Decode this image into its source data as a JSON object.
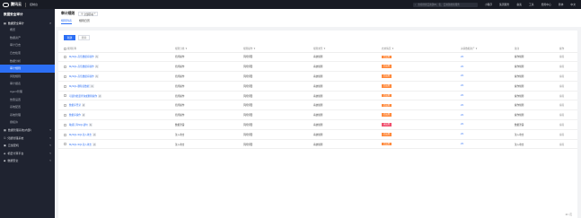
{
  "topbar": {
    "logo_text": "腾讯云",
    "console": "控制台",
    "search_placeholder": "支持搜索云资源ID、名、云资源搜索服务",
    "links": [
      "小程序",
      "集团服务",
      "备案",
      "工具",
      "费用中心",
      "简体",
      "中文"
    ]
  },
  "sidebar": {
    "title": "数据安全审计",
    "group_label": "数据安全审计",
    "items": [
      {
        "label": "概览",
        "active": false
      },
      {
        "label": "数据资产",
        "active": false
      },
      {
        "label": "审计日志",
        "active": false
      },
      {
        "label": "日志检索",
        "active": false
      },
      {
        "label": "数据分析",
        "active": false
      },
      {
        "label": "审计规则",
        "active": true
      },
      {
        "label": "风险规则",
        "active": false
      },
      {
        "label": "审计报表",
        "active": false
      },
      {
        "label": "Agent管理",
        "active": false
      },
      {
        "label": "告警设置",
        "active": false
      },
      {
        "label": "系统配置",
        "active": false
      },
      {
        "label": "系统管理",
        "active": false
      },
      {
        "label": "授权许",
        "active": false
      }
    ],
    "categories": [
      {
        "label": "数据管理系统(内部)"
      },
      {
        "label": "凭据管理系统"
      },
      {
        "label": "云加密机"
      },
      {
        "label": "机密计算平台"
      },
      {
        "label": "数据安全"
      }
    ]
  },
  "page": {
    "title": "审计规则",
    "region": "全部区域",
    "tabs": [
      {
        "label": "规则列表",
        "active": true
      },
      {
        "label": "规则日历",
        "active": false
      }
    ]
  },
  "toolbar": {
    "new_label": "新建",
    "delete_label": "删除"
  },
  "table": {
    "columns": [
      "规则名称",
      "规则分类 ▼",
      "规则操作 ▼",
      "规则类型 ▼",
      "启用情况 ▼",
      "关联数据资产 ▼",
      "备注",
      "操作"
    ],
    "rows": [
      {
        "name": "MySQL-高危数据库操作",
        "tag": "内",
        "category": "危险操作",
        "action": "风险预警",
        "type": "系统规则",
        "status": "已启用",
        "status_color": "#ff8a3d",
        "count": "23",
        "note": "操作规则",
        "op": "编辑"
      },
      {
        "name": "MySQL-高危数据库操作",
        "tag": "内",
        "category": "危险操作",
        "action": "风险预警",
        "type": "系统规则",
        "status": "已启用",
        "status_color": "#ff8a3d",
        "count": "23",
        "note": "操作规则",
        "op": "编辑"
      },
      {
        "name": "MySQL-高危数据库操作",
        "tag": "内",
        "category": "危险操作",
        "action": "风险预警",
        "type": "系统规则",
        "status": "已启用",
        "status_color": "#ff8a3d",
        "count": "23",
        "note": "操作规则",
        "op": "编辑"
      },
      {
        "name": "MySQL-删除表数据",
        "tag": "内",
        "category": "危险操作",
        "action": "风险预警",
        "type": "系统规则",
        "status": "已启用",
        "status_color": "#ff8a3d",
        "count": "23",
        "note": "操作规则",
        "op": "编辑"
      },
      {
        "name": "可疑的批量查询或删除操作",
        "tag": "内",
        "category": "危险操作",
        "action": "风险预警",
        "type": "系统规则",
        "status": "已启用",
        "status_color": "#ff8a3d",
        "count": "23",
        "note": "操作规则",
        "op": "编辑"
      },
      {
        "name": "数据库登录",
        "tag": "内",
        "category": "危险操作",
        "action": "风险预警",
        "type": "系统规则",
        "status": "已启用",
        "status_color": "#ff8a3d",
        "count": "23",
        "note": "操作规则",
        "op": "编辑"
      },
      {
        "name": "数据库操作",
        "tag": "内",
        "category": "危险操作",
        "action": "风险预警",
        "type": "系统规则",
        "status": "已启用",
        "status_color": "#ff8a3d",
        "count": "23",
        "note": "操作规则",
        "op": "编辑"
      },
      {
        "name": "敏感打印SQL语句",
        "tag": "内",
        "category": "数据泄露",
        "action": "风险预警",
        "type": "系统规则",
        "status": "未启用",
        "status_color": "#f0506e",
        "count": "23",
        "note": "数据泄露",
        "op": "编辑"
      },
      {
        "name": "MySQL-SQL注入攻击",
        "tag": "内",
        "category": "注入攻击",
        "action": "风险预警",
        "type": "系统规则",
        "status": "已启用",
        "status_color": "#ff8a3d",
        "count": "23",
        "note": "注入攻击",
        "op": "编辑"
      },
      {
        "name": "MySQL-SQL注入攻击",
        "tag": "内",
        "category": "注入攻击",
        "action": "风险预警",
        "type": "系统规则",
        "status": "已启用",
        "status_color": "#ff8a3d",
        "count": "23",
        "note": "注入攻击",
        "op": "编辑"
      }
    ]
  },
  "pagination": {
    "text": "10 / 页"
  }
}
